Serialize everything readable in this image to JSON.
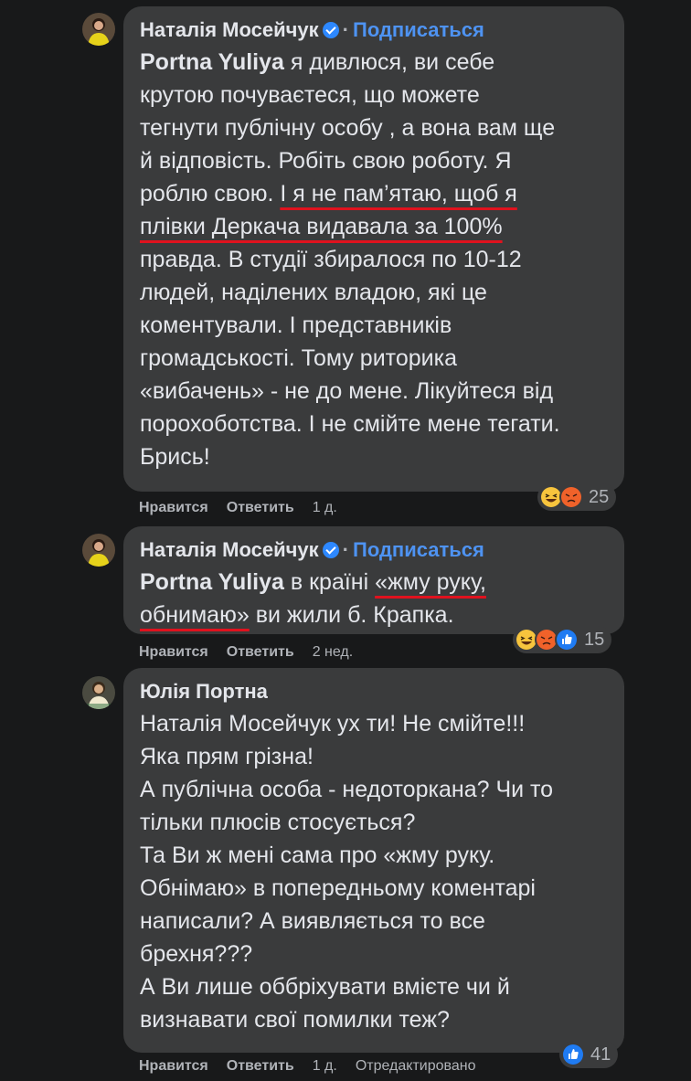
{
  "comments": [
    {
      "author": "Наталія Мосейчук",
      "subscribe": "Подписаться",
      "mention": "Portna Yuliya",
      "text_1": " я дивлюся, ви себе",
      "text_2": "крутою почуваєтеся, що можете",
      "text_3": "тегнути публічну особу , а вона вам ще",
      "text_4": "й відповість. Робіть свою роботу. Я",
      "text_5a": "роблю свою. ",
      "text_5b": "І я не пам’ятаю, щоб я",
      "text_6": "плівки Деркача видавала за 100%",
      "text_7": "правда. В студії збиралося по 10-12",
      "text_8": "людей, наділених владою, які це",
      "text_9": "коментували. І представників",
      "text_10": "громадськості. Тому риторика",
      "text_11": "«вибачень» - не до мене. Лікуйтеся від",
      "text_12": "порохоботства. І не смійте мене тегати.",
      "text_13": "Брись!",
      "like": "Нравится",
      "reply": "Ответить",
      "time": "1 д.",
      "reactions": [
        "haha",
        "angry"
      ],
      "reaction_count": "25"
    },
    {
      "author": "Наталія Мосейчук",
      "subscribe": "Подписаться",
      "mention": "Portna Yuliya",
      "text_1a": " в країні ",
      "text_1b": "«жму руку,",
      "text_2a": "обнимаю»",
      "text_2b": " ви жили б. Крапка.",
      "like": "Нравится",
      "reply": "Ответить",
      "time": "2 нед.",
      "reactions": [
        "haha",
        "angry",
        "like"
      ],
      "reaction_count": "15"
    },
    {
      "author": "Юлія Портна",
      "text_1": "Наталія Мосейчук ух ти! Не смійте!!!",
      "text_2": "Яка прям грізна!",
      "text_3": "А публічна особа - недоторкана? Чи то",
      "text_4": "тільки плюсів стосується?",
      "text_5": "Та Ви ж мені сама про «жму руку.",
      "text_6": "Обнімаю» в попередньому коментарі",
      "text_7": "написали? А виявляється то все",
      "text_8": "брехня???",
      "text_9": "А Ви лише оббріхувати вмієте чи й",
      "text_10": "визнавати свої помилки теж?",
      "like": "Нравится",
      "reply": "Ответить",
      "time": "1 д.",
      "edited": "Отредактировано",
      "reactions": [
        "like"
      ],
      "reaction_count": "41"
    }
  ],
  "colors": {
    "background": "#18191a",
    "bubble": "#3a3b3c",
    "text": "#e4e6eb",
    "secondary": "#b0b3b8",
    "link": "#4e93f2",
    "underline": "#e0121e",
    "verified": "#2d88ff"
  }
}
